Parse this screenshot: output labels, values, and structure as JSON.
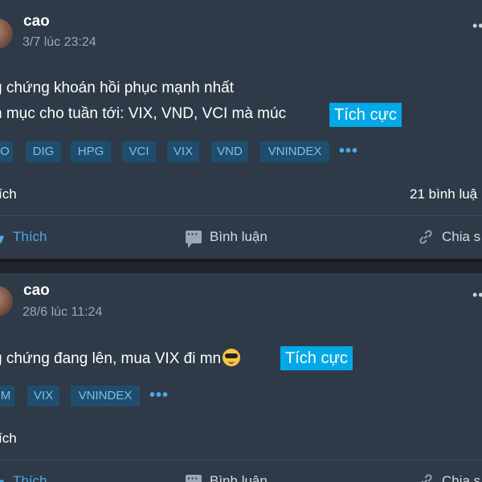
{
  "posts": [
    {
      "author": "cao",
      "timestamp": "3/7 lúc 23:24",
      "lines": [
        "g chứng khoán hồi phục mạnh nhất",
        "h mục cho tuần tới: VIX, VND, VCI mà múc"
      ],
      "sentiment": "Tích cực",
      "tags": [
        "O",
        "DIG",
        "HPG",
        "VCI",
        "VIX",
        "VND",
        "VNINDEX"
      ],
      "more_tags": "•••",
      "likes_label": "ích",
      "comments_label": "21 bình luậ",
      "actions": {
        "like": "Thích",
        "comment": "Bình luận",
        "share": "Chia s"
      },
      "more": "•••"
    },
    {
      "author": "cao",
      "timestamp": "28/6 lúc 11:24",
      "line": "g chứng đang lên, mua VIX đi mn",
      "sentiment": "Tích cực",
      "tags": [
        "M",
        "VIX",
        "VNINDEX"
      ],
      "more_tags": "•••",
      "likes_label": "ích",
      "actions": {
        "like": "Thích",
        "comment": "Bình luận",
        "share": "Chia s"
      },
      "more": "•••"
    }
  ],
  "colors": {
    "background": "#2e3a47",
    "accent": "#00a8e8",
    "tag_bg": "#1e4d6e",
    "tag_text": "#7fbfe8"
  },
  "icons": {
    "like": "thumbs-up-icon",
    "comment": "comment-icon",
    "share": "share-icon",
    "emoji": "sunglasses-emoji-icon"
  }
}
